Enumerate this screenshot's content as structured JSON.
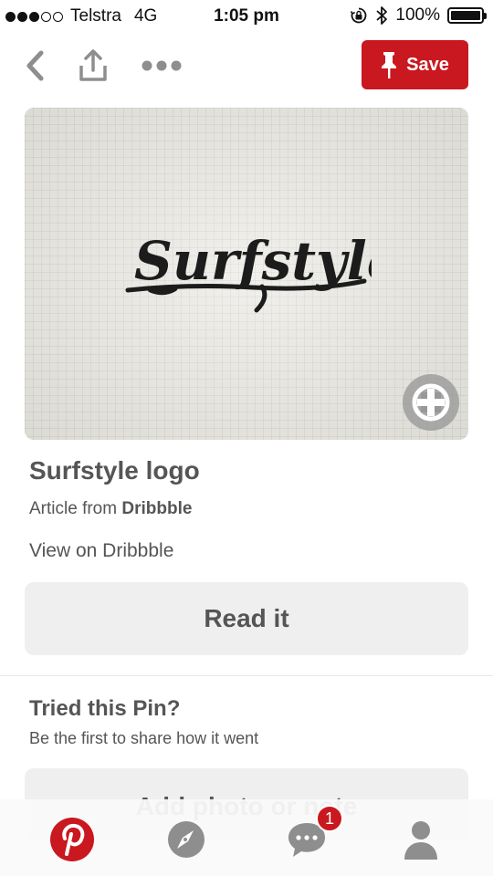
{
  "status_bar": {
    "carrier": "Telstra",
    "network": "4G",
    "time": "1:05 pm",
    "battery": "100%",
    "signal_bars": 3
  },
  "toolbar": {
    "back_icon": "chevron-left-icon",
    "share_icon": "share-icon",
    "more_icon": "more-dots-icon",
    "save_label": "Save"
  },
  "pin": {
    "image_text": "Surfstyle",
    "title": "Surfstyle logo",
    "source_prefix": "Article from",
    "source_name": "Dribbble",
    "view_link": "View on Dribbble",
    "read_button": "Read it"
  },
  "tried": {
    "title": "Tried this Pin?",
    "subtitle": "Be the first to share how it went",
    "add_button": "Add photo or note"
  },
  "tab_bar": {
    "items": [
      {
        "name": "home",
        "icon": "pinterest-logo-icon"
      },
      {
        "name": "explore",
        "icon": "compass-icon"
      },
      {
        "name": "messages",
        "icon": "chat-bubble-icon",
        "badge": "1"
      },
      {
        "name": "profile",
        "icon": "person-icon"
      }
    ]
  },
  "colors": {
    "brand_red": "#c9181f",
    "text_gray": "#555555",
    "button_gray": "#efefef"
  }
}
